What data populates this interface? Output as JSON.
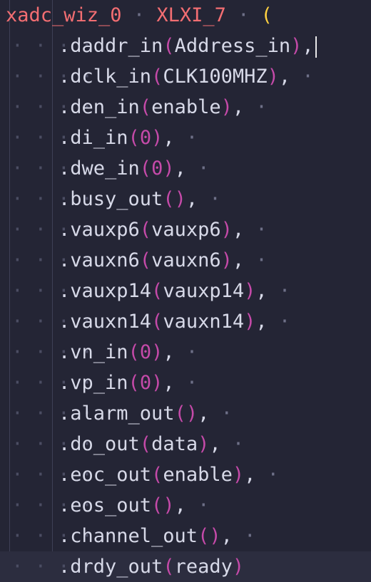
{
  "header": {
    "module": "xadc_wiz_0",
    "instance": "XLXI_7",
    "open_paren": "("
  },
  "ports": [
    {
      "name": ".daddr_in",
      "arg": "Address_in",
      "arg_kind": "ident",
      "sep": ","
    },
    {
      "name": ".dclk_in",
      "arg": "CLK100MHZ",
      "arg_kind": "ident",
      "sep": ","
    },
    {
      "name": ".den_in",
      "arg": "enable",
      "arg_kind": "ident",
      "sep": ","
    },
    {
      "name": ".di_in",
      "arg": "0",
      "arg_kind": "number",
      "sep": ","
    },
    {
      "name": ".dwe_in",
      "arg": "0",
      "arg_kind": "number",
      "sep": ","
    },
    {
      "name": ".busy_out",
      "arg": "",
      "arg_kind": "empty",
      "sep": ","
    },
    {
      "name": ".vauxp6",
      "arg": "vauxp6",
      "arg_kind": "ident",
      "sep": ","
    },
    {
      "name": ".vauxn6",
      "arg": "vauxn6",
      "arg_kind": "ident",
      "sep": ","
    },
    {
      "name": ".vauxp14",
      "arg": "vauxp14",
      "arg_kind": "ident",
      "sep": ","
    },
    {
      "name": ".vauxn14",
      "arg": "vauxn14",
      "arg_kind": "ident",
      "sep": ","
    },
    {
      "name": ".vn_in",
      "arg": "0",
      "arg_kind": "number",
      "sep": ","
    },
    {
      "name": ".vp_in",
      "arg": "0",
      "arg_kind": "number",
      "sep": ","
    },
    {
      "name": ".alarm_out",
      "arg": "",
      "arg_kind": "empty",
      "sep": ","
    },
    {
      "name": ".do_out",
      "arg": "data",
      "arg_kind": "ident",
      "sep": ","
    },
    {
      "name": ".eoc_out",
      "arg": "enable",
      "arg_kind": "ident",
      "sep": ","
    },
    {
      "name": ".eos_out",
      "arg": "",
      "arg_kind": "empty",
      "sep": ","
    },
    {
      "name": ".channel_out",
      "arg": "",
      "arg_kind": "empty",
      "sep": ","
    },
    {
      "name": ".drdy_out",
      "arg": "ready",
      "arg_kind": "ident",
      "sep": ""
    }
  ],
  "syntax_colors": {
    "background": "#242535",
    "module": "#f36e72",
    "paren_outer": "#ffd140",
    "paren_inner": "#c54aa9",
    "text": "#d7d9e8",
    "whitespace_dot": "#6e7088"
  }
}
